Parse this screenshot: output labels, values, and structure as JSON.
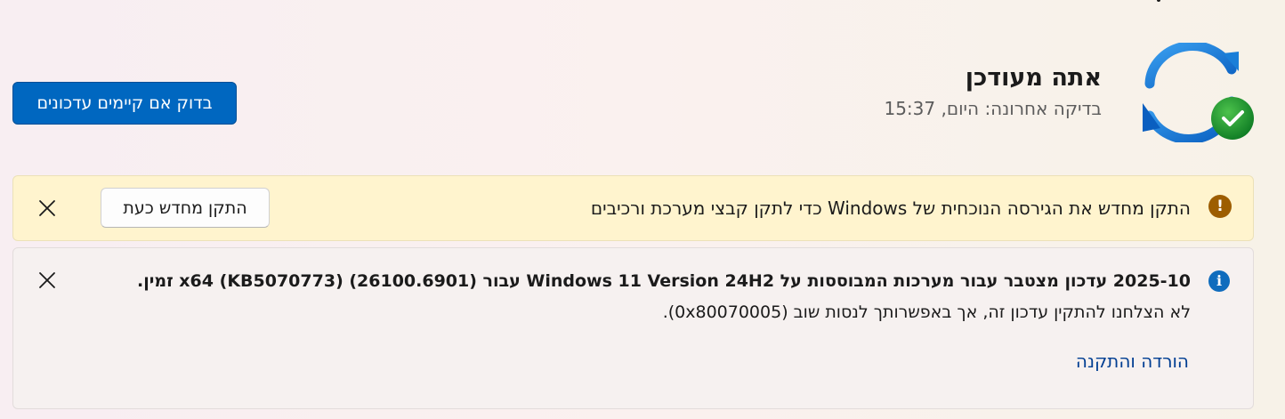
{
  "status": {
    "title": "אתה מעודכן",
    "last_checked": "בדיקה אחרונה: היום, 15:37",
    "check_button_label": "בדוק אם קיימים עדכונים",
    "icon": "sync-check-icon"
  },
  "warning_bar": {
    "icon": "warning-icon",
    "icon_glyph": "!",
    "message": "התקן מחדש את הגירסה הנוכחית של Windows כדי לתקן קבצי מערכת ורכיבים",
    "action_label": "התקן מחדש כעת",
    "close_icon": "close-icon"
  },
  "info_bar": {
    "icon": "info-icon",
    "icon_glyph": "i",
    "title": "2025-10 עדכון מצטבר עבור מערכות המבוססות על Windows 11 Version 24H2 עבור (26100.6901) (KB5070773) x64 זמין.",
    "message": "לא הצלחנו להתקין עדכון זה, אך באפשרותך לנסות שוב (0x80070005).",
    "link_label": "הורדה והתקנה",
    "close_icon": "close-icon"
  },
  "colors": {
    "accent": "#0067c0",
    "warning_bg": "#fff4ce",
    "warning_icon": "#9d5d00",
    "info_icon": "#0f6cbd",
    "success": "#10893e",
    "link": "#003e92"
  }
}
